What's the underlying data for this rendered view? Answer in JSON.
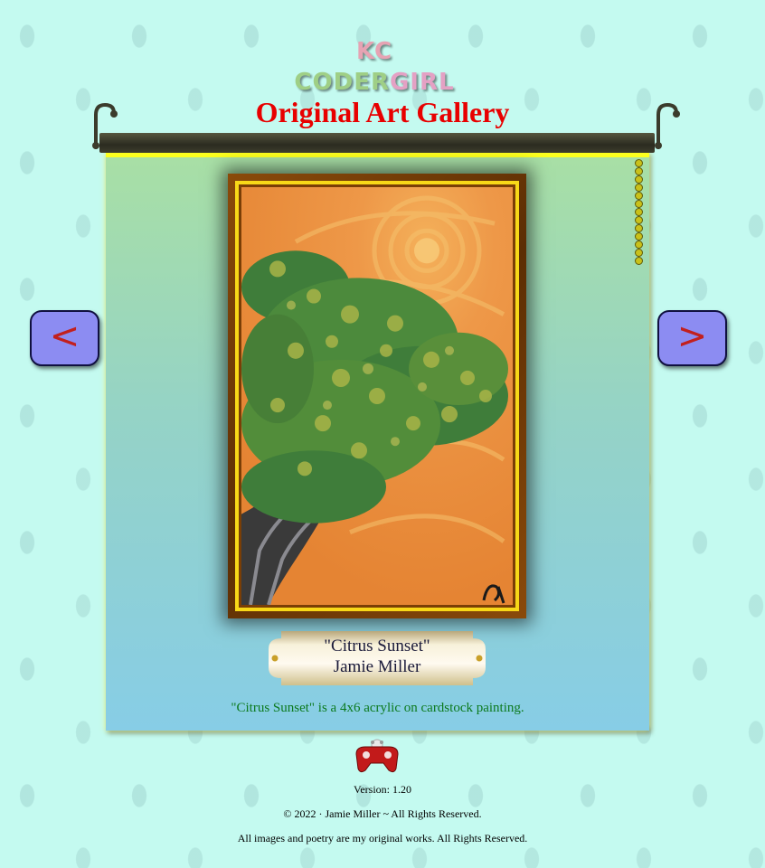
{
  "logo": {
    "word1": "KC",
    "word2": "CODER",
    "word3": "GIRL"
  },
  "gallery": {
    "title": "Original Art Gallery",
    "prev_label": "<",
    "next_label": ">"
  },
  "artwork": {
    "title": "\"Citrus Sunset\"",
    "artist": "Jamie Miller",
    "description": "\"Citrus Sunset\" is a 4x6 acrylic on cardstock painting."
  },
  "footer": {
    "version": "Version: 1.20",
    "copyright": "© 2022 · Jamie Miller ~ All Rights Reserved.",
    "rights_note": "All images and poetry are my original works. All Rights Reserved."
  },
  "icons": [
    "hanger-hook-icon",
    "pull-chain-icon",
    "game-controller-icon"
  ],
  "colors": {
    "title": "#e80000",
    "nav_button": "#8c8cf2",
    "nav_arrow": "#c2201e",
    "description": "#0c7a1e",
    "frame_gold": "#f8d818",
    "background": "#c4faf0"
  }
}
